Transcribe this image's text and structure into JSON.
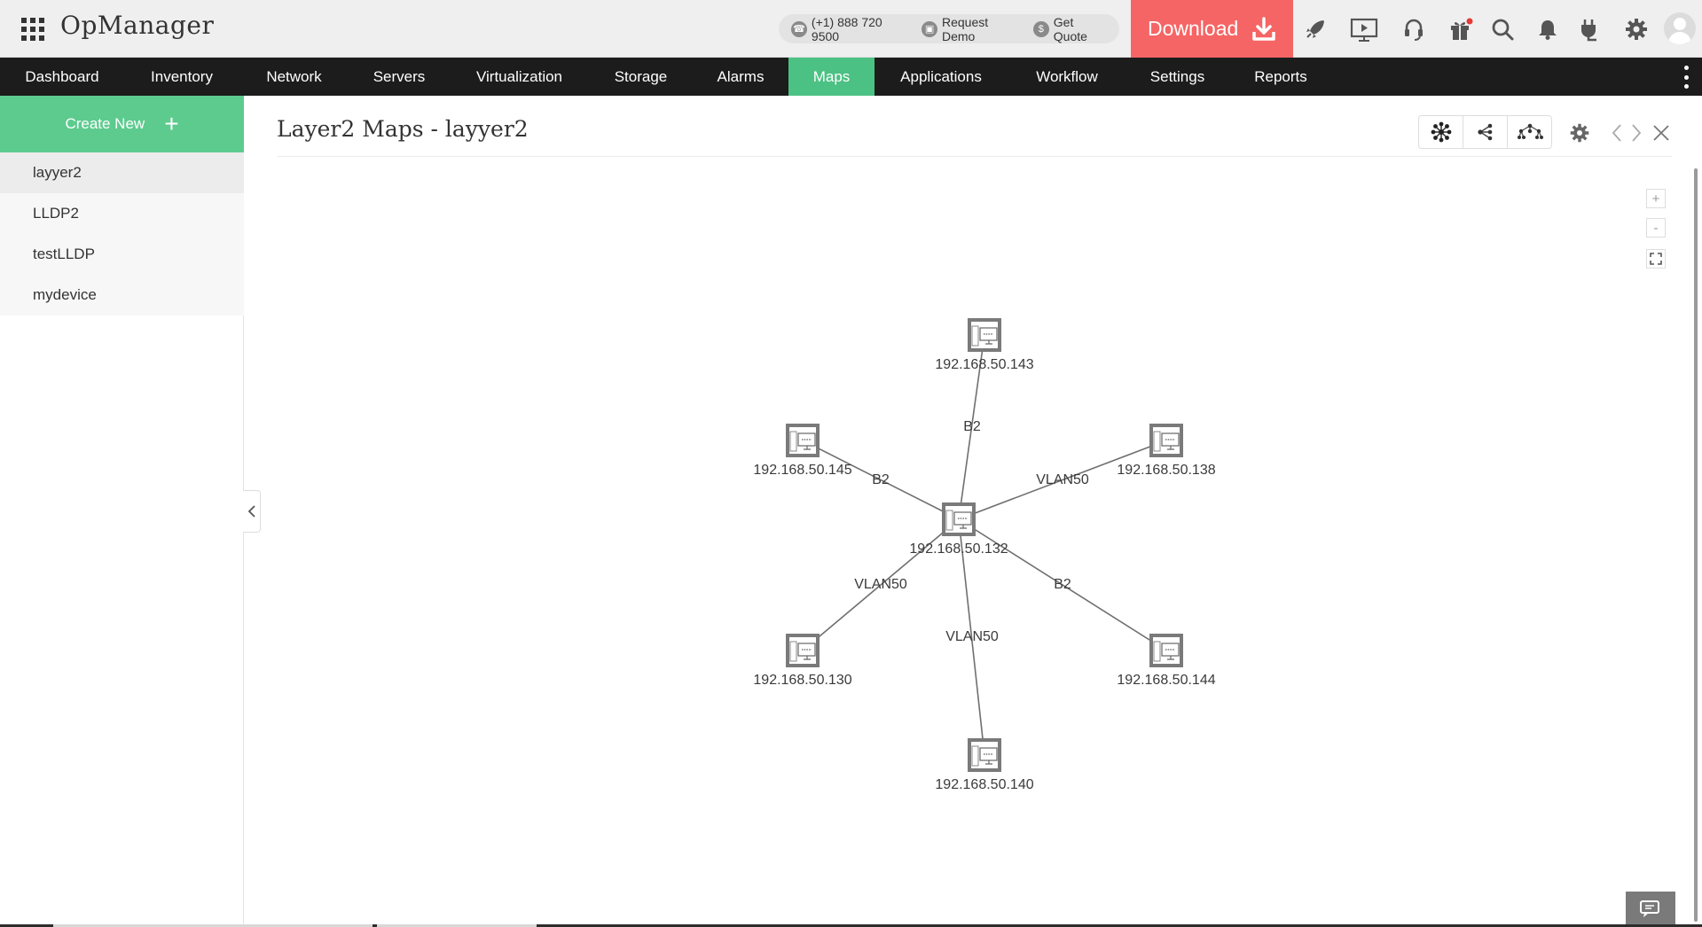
{
  "header": {
    "brand": "OpManager",
    "phone": "(+1) 888 720 9500",
    "request_demo": "Request Demo",
    "get_quote": "Get Quote",
    "download_label": "Download",
    "tool_icons": [
      "rocket-icon",
      "presentation-icon",
      "headset-icon",
      "gift-icon",
      "search-icon",
      "bell-icon",
      "plug-icon",
      "gear-icon"
    ]
  },
  "nav": {
    "items": [
      "Dashboard",
      "Inventory",
      "Network",
      "Servers",
      "Virtualization",
      "Storage",
      "Alarms",
      "Maps",
      "Applications",
      "Workflow",
      "Settings",
      "Reports"
    ],
    "active": "Maps",
    "accent": "#4cc184"
  },
  "sidebar": {
    "create_new_label": "Create New",
    "maps": [
      "layyer2",
      "LLDP2",
      "testLLDP",
      "mydevice"
    ],
    "active_map": "layyer2"
  },
  "main": {
    "title": "Layer2 Maps - layyer2",
    "zoom_in": "+",
    "zoom_out": "-"
  },
  "topology": {
    "center": "192.168.50.132",
    "devices": [
      "192.168.50.132",
      "192.168.50.143",
      "192.168.50.145",
      "192.168.50.138",
      "192.168.50.130",
      "192.168.50.144",
      "192.168.50.140"
    ],
    "links": [
      {
        "from": "192.168.50.132",
        "to": "192.168.50.143",
        "label": "B2"
      },
      {
        "from": "192.168.50.132",
        "to": "192.168.50.145",
        "label": "B2"
      },
      {
        "from": "192.168.50.132",
        "to": "192.168.50.138",
        "label": "VLAN50"
      },
      {
        "from": "192.168.50.132",
        "to": "192.168.50.130",
        "label": "VLAN50"
      },
      {
        "from": "192.168.50.132",
        "to": "192.168.50.144",
        "label": "B2"
      },
      {
        "from": "192.168.50.132",
        "to": "192.168.50.140",
        "label": "VLAN50"
      }
    ]
  }
}
